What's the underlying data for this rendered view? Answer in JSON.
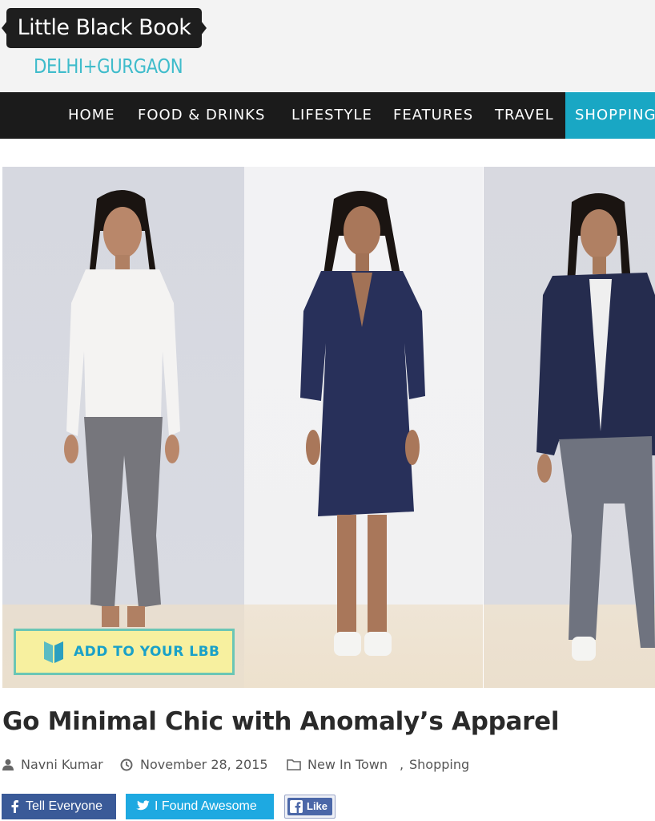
{
  "site": {
    "logo_text": "Little Black Book",
    "city": "DELHI+GURGAON"
  },
  "nav": {
    "items": [
      {
        "label": "HOME"
      },
      {
        "label": "FOOD & DRINKS"
      },
      {
        "label": "LIFESTYLE"
      },
      {
        "label": "FEATURES"
      },
      {
        "label": "TRAVEL"
      },
      {
        "label": "SHOPPING",
        "active": true
      }
    ]
  },
  "hero": {
    "add_button_label": "ADD TO YOUR LBB"
  },
  "article": {
    "title": "Go Minimal Chic with Anomaly’s Apparel",
    "author": "Navni Kumar",
    "date": "November 28, 2015",
    "categories": [
      "New In Town",
      "Shopping"
    ],
    "category_separator": ","
  },
  "share": {
    "facebook_label": "Tell Everyone",
    "twitter_label": "I Found Awesome",
    "like_label": "Like"
  },
  "colors": {
    "nav_background": "#1b1b1b",
    "nav_active": "#19a7c4",
    "city_accent": "#3fbccb",
    "lbb_button_fill": "#f7f09f",
    "lbb_button_border": "#6bc6b5",
    "facebook": "#3a5a98",
    "twitter": "#1ea9e1"
  },
  "icons": {
    "author": "user-icon",
    "date": "clock-icon",
    "category": "folder-icon",
    "lbb": "book-icon",
    "facebook": "facebook-icon",
    "twitter": "twitter-icon"
  }
}
